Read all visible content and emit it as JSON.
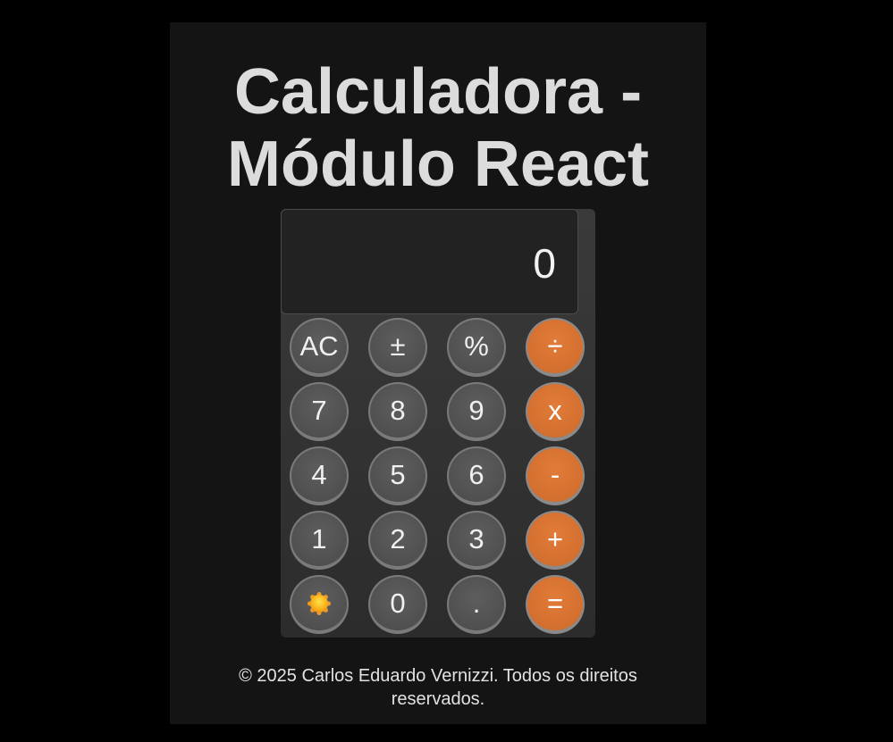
{
  "app": {
    "title": "Calculadora - Módulo React"
  },
  "display": {
    "value": "0"
  },
  "keypad": {
    "ac": "AC",
    "sign": "±",
    "percent": "%",
    "divide": "÷",
    "seven": "7",
    "eight": "8",
    "nine": "9",
    "multiply": "x",
    "four": "4",
    "five": "5",
    "six": "6",
    "minus": "-",
    "one": "1",
    "two": "2",
    "three": "3",
    "plus": "+",
    "theme_icon": "sun-icon",
    "zero": "0",
    "decimal": ".",
    "equals": "="
  },
  "footer": {
    "text": "© 2025 Carlos Eduardo Vernizzi. Todos os direitos reservados."
  },
  "colors": {
    "background": "#000000",
    "panel": "#141414",
    "operator": "#d36f2f",
    "number_key": "#505050",
    "display": "#222222",
    "text": "#dcdcdc"
  }
}
